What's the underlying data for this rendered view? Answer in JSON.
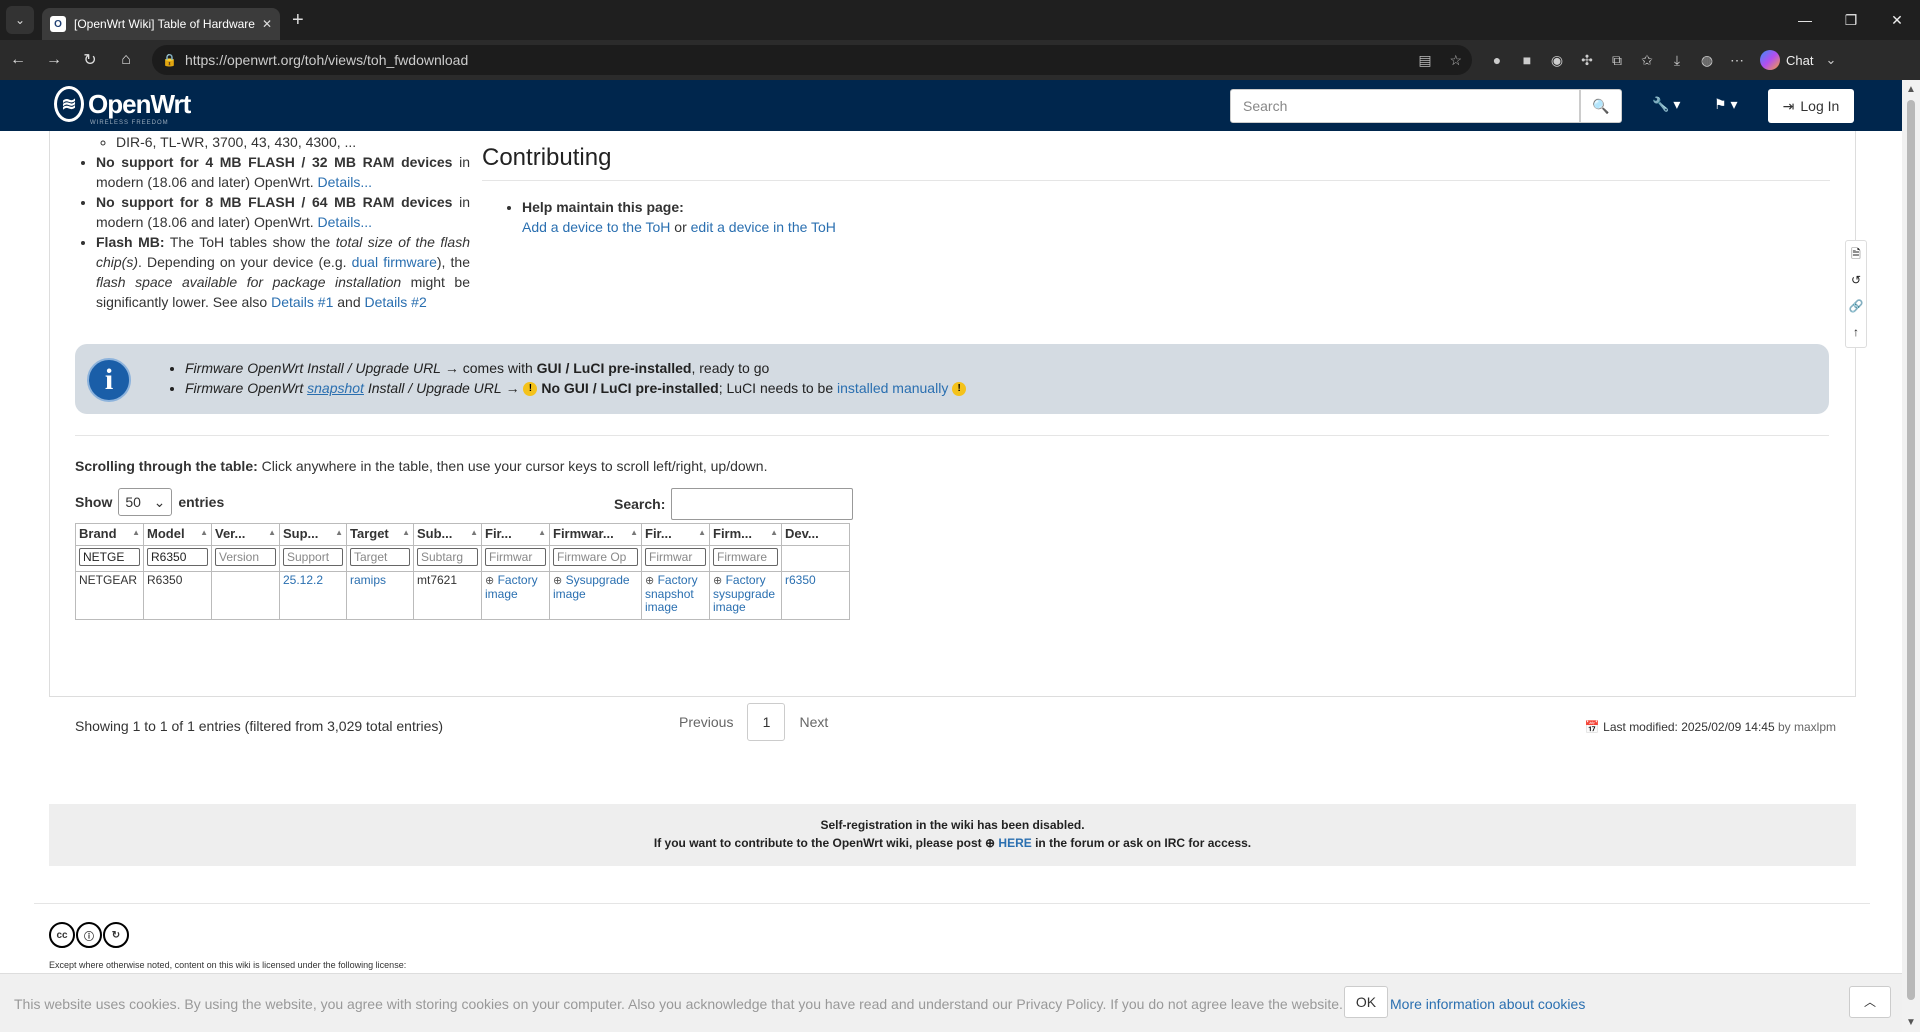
{
  "browser": {
    "tab_title": "[OpenWrt Wiki] Table of Hardware",
    "url": "https://openwrt.org/toh/views/toh_fwdownload",
    "chat_label": "Chat"
  },
  "header": {
    "logo_name": "OpenWrt",
    "logo_sub": "WIRELESS FREEDOM",
    "search_placeholder": "Search",
    "login_label": "Log In"
  },
  "left": {
    "sub_item": "DIR-6, TL-WR, 3700, 43, 430, 4300, ...",
    "item1_bold": "No support for 4 MB FLASH / 32 MB RAM devices",
    "item1_rest": " in modern (18.06 and later) OpenWrt. ",
    "item2_bold": "No support for 8 MB FLASH / 64 MB RAM devices",
    "item2_rest": " in modern (18.06 and later) OpenWrt. ",
    "details": "Details...",
    "flash_bold": "Flash MB:",
    "flash_a": " The ToH tables show the ",
    "flash_em1": "total size of the flash chip(s)",
    "flash_b": ". Depending on your device (e.g. ",
    "flash_link": "dual firmware",
    "flash_c": "), the ",
    "flash_em2": "flash space available for package installation",
    "flash_d": " might be significantly lower. See also ",
    "details1": "Details #1",
    "and": " and ",
    "details2": "Details #2"
  },
  "contrib": {
    "title": "Contributing",
    "help": "Help maintain this page:",
    "add": "Add a device to the ToH",
    "or": " or ",
    "edit": "edit a device in the ToH"
  },
  "info": {
    "line1_em": "Firmware OpenWrt Install / Upgrade URL",
    "line1_arrow": " → comes with ",
    "line1_bold": "GUI / LuCI pre-installed",
    "line1_rest": ", ready to go",
    "line2_em1": "Firmware OpenWrt ",
    "line2_link": "snapshot",
    "line2_em2": " Install / Upgrade URL",
    "line2_arrow": " → ",
    "line2_bold": "No GUI / LuCI pre-installed",
    "line2_rest": "; LuCI needs to be ",
    "line2_link2": "installed manually"
  },
  "table_controls": {
    "scroll_bold": "Scrolling through the table:",
    "scroll_rest": " Click anywhere in the table, then use your cursor keys to scroll left/right, up/down.",
    "show": "Show",
    "show_value": "50",
    "entries": "entries",
    "search": "Search:"
  },
  "table": {
    "headers": [
      "Brand",
      "Model",
      "Ver...",
      "Sup...",
      "Target",
      "Sub...",
      "Fir...",
      "Firmwar...",
      "Fir...",
      "Firm...",
      "Dev..."
    ],
    "filters": [
      "NETGE",
      "R6350",
      "Version",
      "Support",
      "Target",
      "Subtarg",
      "Firmwar",
      "Firmware Op",
      "Firmwar",
      "Firmware",
      ""
    ],
    "row": {
      "brand": "NETGEAR",
      "model": "R6350",
      "version": "",
      "supported": "25.12.2",
      "target": "ramips",
      "subtarget": "mt7621",
      "fw_factory": "Factory image",
      "fw_sysupgrade": "Sysupgrade image",
      "fw_factory_snap": "Factory snapshot image",
      "fw_sysupgrade_snap": "Factory sysupgrade image",
      "devpage": "r6350"
    }
  },
  "pagination": {
    "showing": "Showing 1 to 1 of 1 entries (filtered from 3,029 total entries)",
    "previous": "Previous",
    "current": "1",
    "next": "Next"
  },
  "lastmod": {
    "text": "Last modified: 2025/02/09 14:45",
    "by": "by maxlpm"
  },
  "selfreg": {
    "line1": "Self-registration in the wiki has been disabled.",
    "line2a": "If you want to contribute to the OpenWrt wiki, please post ",
    "here": "HERE",
    "line2b": " in the forum or ask on IRC for access."
  },
  "license": "Except where otherwise noted, content on this wiki is licensed under the following license:",
  "cookie": {
    "text": "This website uses cookies. By using the website, you agree with storing cookies on your computer. Also you acknowledge that you have read and understand our Privacy Policy. If you do not agree leave the website.",
    "ok": "OK",
    "more": "More information about cookies"
  }
}
